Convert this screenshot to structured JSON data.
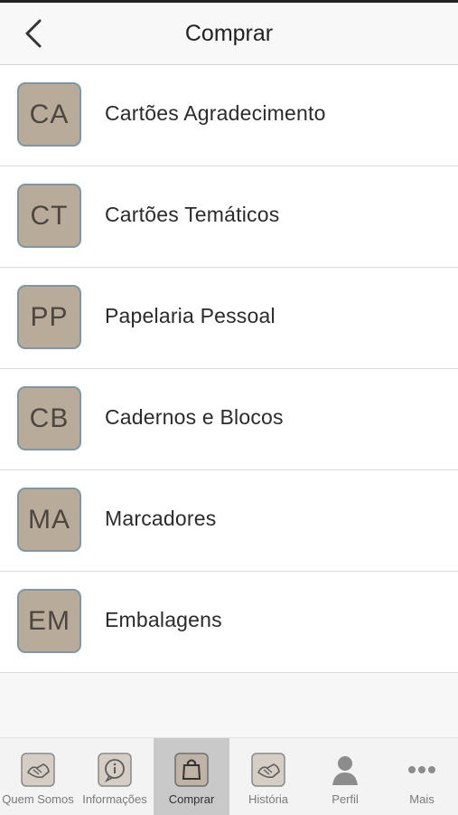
{
  "header": {
    "title": "Comprar",
    "back_icon": "chevron-left-icon"
  },
  "categories": [
    {
      "code": "CA",
      "label": "Cartões Agradecimento"
    },
    {
      "code": "CT",
      "label": "Cartões Temáticos"
    },
    {
      "code": "PP",
      "label": "Papelaria Pessoal"
    },
    {
      "code": "CB",
      "label": "Cadernos e Blocos"
    },
    {
      "code": "MA",
      "label": "Marcadores"
    },
    {
      "code": "EM",
      "label": "Embalagens"
    }
  ],
  "tabbar": {
    "active_tab": "Comprar",
    "tabs": [
      {
        "label": "Quem Somos",
        "icon": "handshake-icon"
      },
      {
        "label": "Informações",
        "icon": "info-icon"
      },
      {
        "label": "Comprar",
        "icon": "shopping-bag-icon"
      },
      {
        "label": "História",
        "icon": "handshake-icon"
      },
      {
        "label": "Perfil",
        "icon": "person-icon"
      },
      {
        "label": "Mais",
        "icon": "more-dots-icon"
      }
    ]
  },
  "colors": {
    "badge_fill": "#b9ab9a",
    "badge_border": "#7f97a4",
    "active_tab": "#c9c9c9"
  }
}
